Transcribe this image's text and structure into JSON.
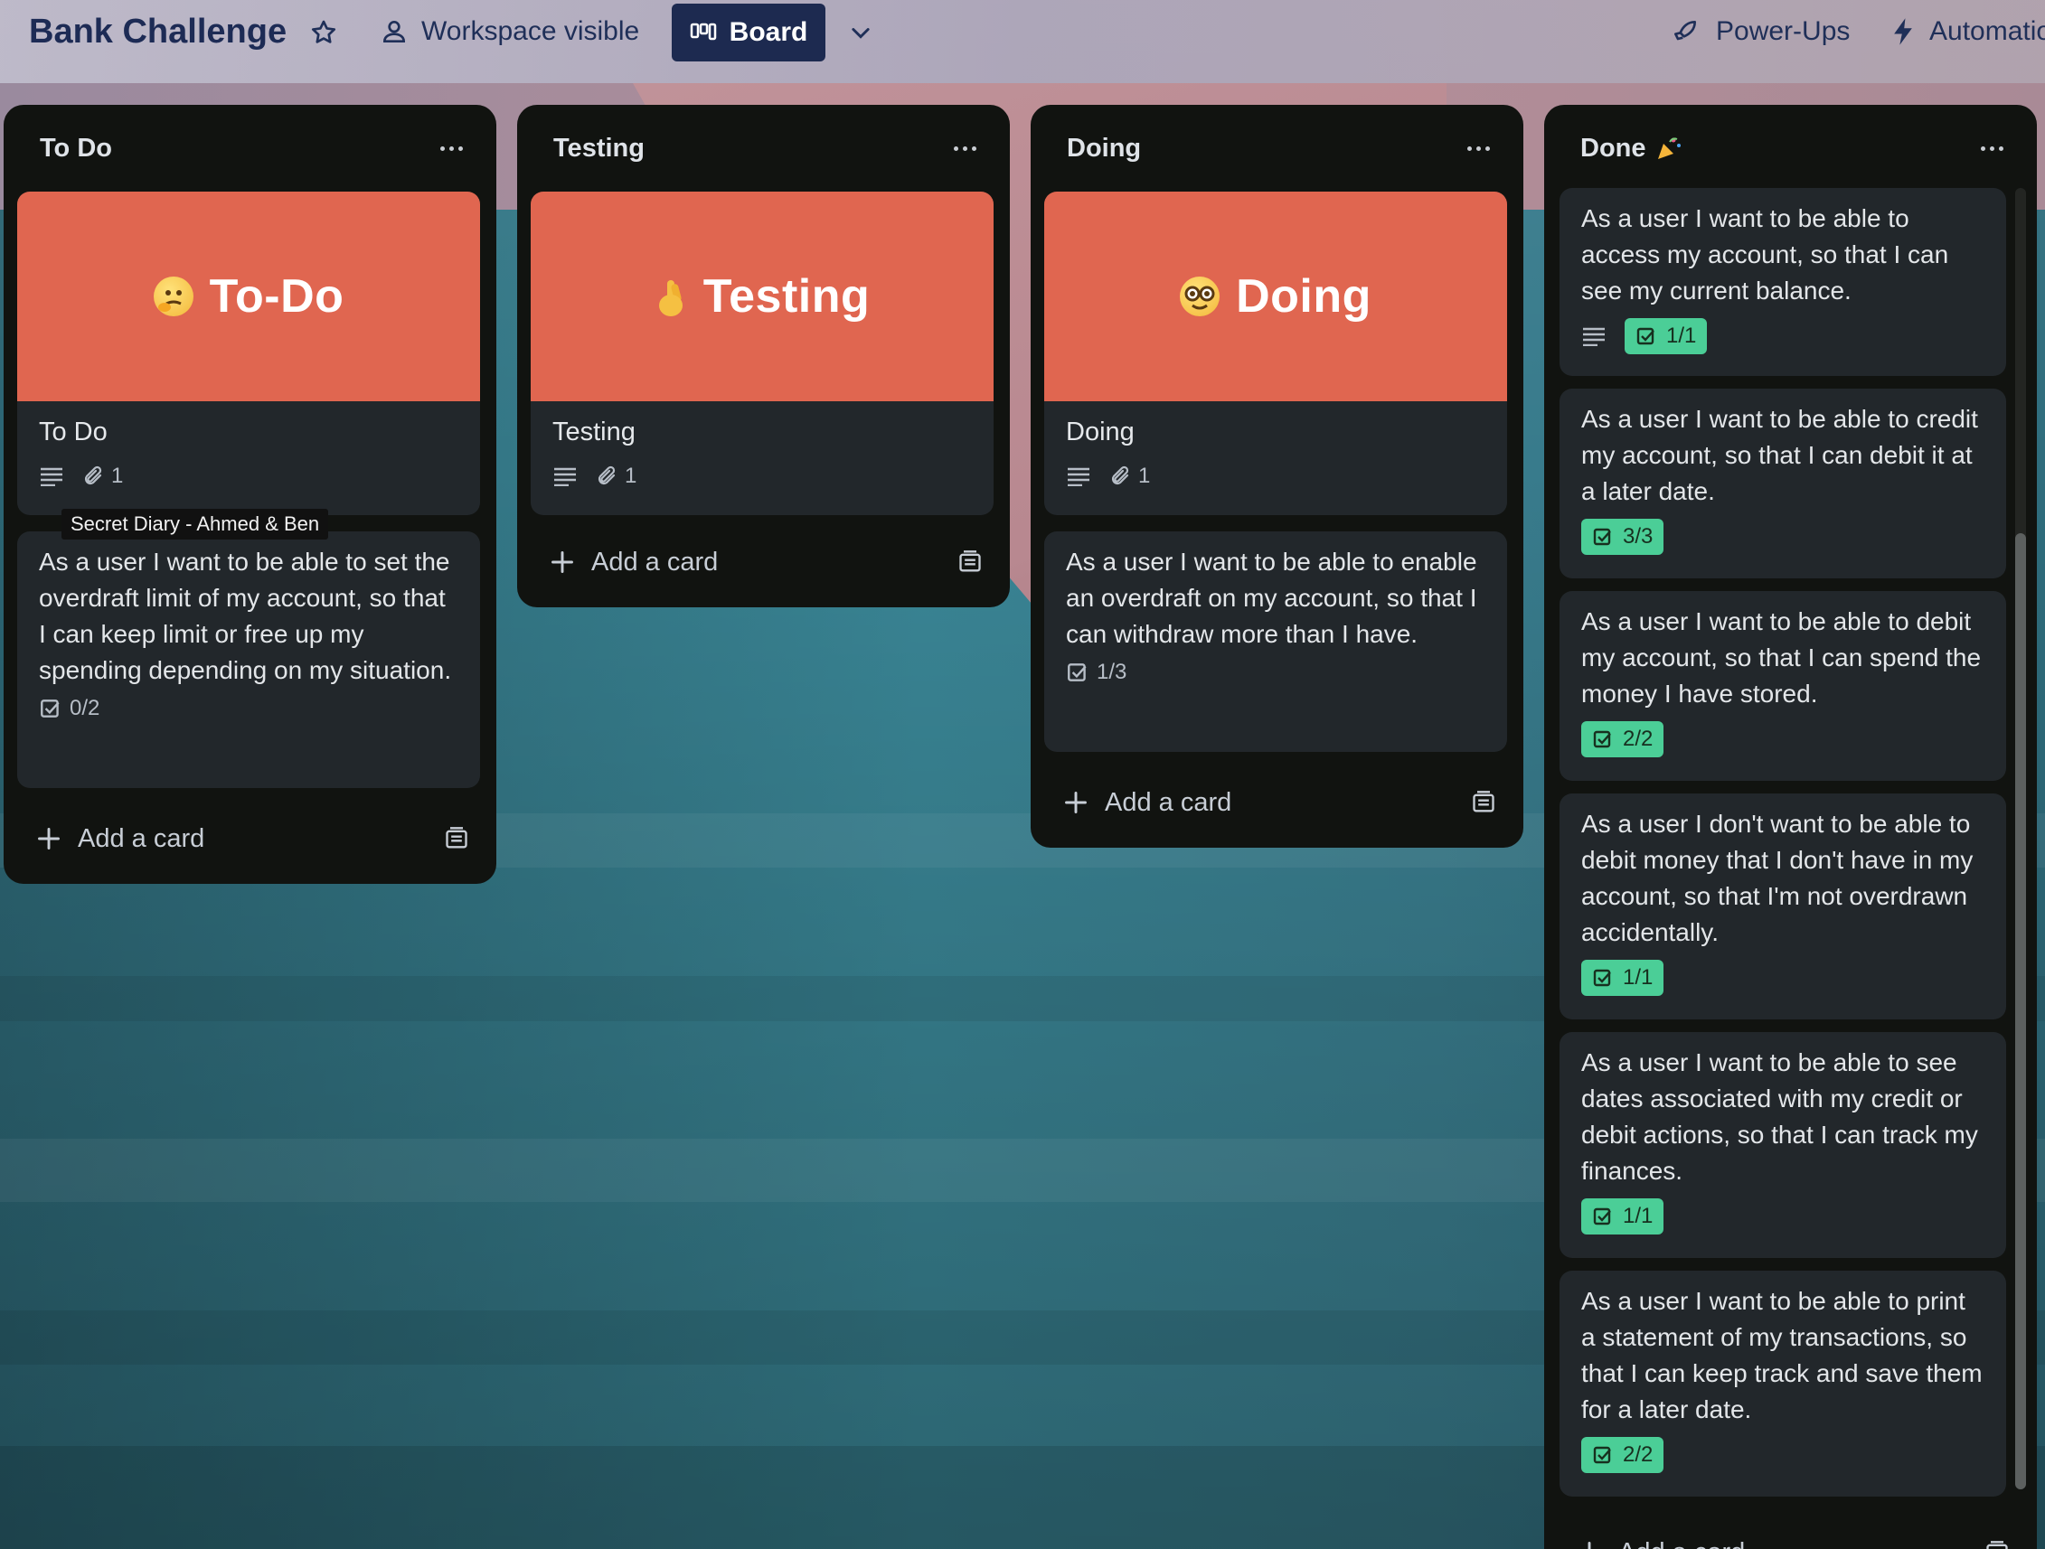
{
  "board": {
    "title": "Bank Challenge",
    "visibility": "Workspace visible",
    "view_label": "Board",
    "power_ups": "Power-Ups",
    "automation": "Automatio"
  },
  "colors": {
    "cover": "#e06650",
    "list_bg": "#111310",
    "card_bg": "#22272b",
    "badge_complete": "#4bce97",
    "topbar_text": "#1d2b55"
  },
  "tooltip": "Secret Diary - Ahmed & Ben",
  "add_card_label": "Add a card",
  "lists": [
    {
      "title": "To Do",
      "cover": {
        "emoji": "thinking-face",
        "text": "To-Do"
      },
      "cover_card": {
        "title": "To Do",
        "attachments": "1"
      },
      "cards": [
        {
          "text": "As a user I want to be able to set the overdraft limit of my account, so that I can keep limit or free up my spending depending on my situation.",
          "checklist": "0/2",
          "complete": false
        }
      ]
    },
    {
      "title": "Testing",
      "cover": {
        "emoji": "crossed-fingers",
        "text": "Testing"
      },
      "cover_card": {
        "title": "Testing",
        "attachments": "1"
      },
      "cards": []
    },
    {
      "title": "Doing",
      "cover": {
        "emoji": "nerd-face",
        "text": "Doing"
      },
      "cover_card": {
        "title": "Doing",
        "attachments": "1"
      },
      "cards": [
        {
          "text": "As a user I want to be able to enable an overdraft on my account, so that I can withdraw more than I have.",
          "checklist": "1/3",
          "complete": false
        }
      ]
    },
    {
      "title": "Done",
      "title_emoji": "party-popper",
      "cards": [
        {
          "text": "As a user I want to be able to access my account, so that I can see my current balance.",
          "checklist": "1/1",
          "complete": true,
          "has_description": true
        },
        {
          "text": "As a user I want to be able to credit my account, so that I can debit it at a later date.",
          "checklist": "3/3",
          "complete": true
        },
        {
          "text": "As a user I want to be able to debit my account, so that I can spend the money I have stored.",
          "checklist": "2/2",
          "complete": true
        },
        {
          "text": "As a user I don't want to be able to debit money that I don't have in my account, so that I'm not overdrawn accidentally.",
          "checklist": "1/1",
          "complete": true
        },
        {
          "text": "As a user I want to be able to see dates associated with my credit or debit actions, so that I can track my finances.",
          "checklist": "1/1",
          "complete": true
        },
        {
          "text": "As a user I want to be able to print a statement of my transactions, so that I can keep track and save them for a later date.",
          "checklist": "2/2",
          "complete": true
        }
      ]
    }
  ]
}
